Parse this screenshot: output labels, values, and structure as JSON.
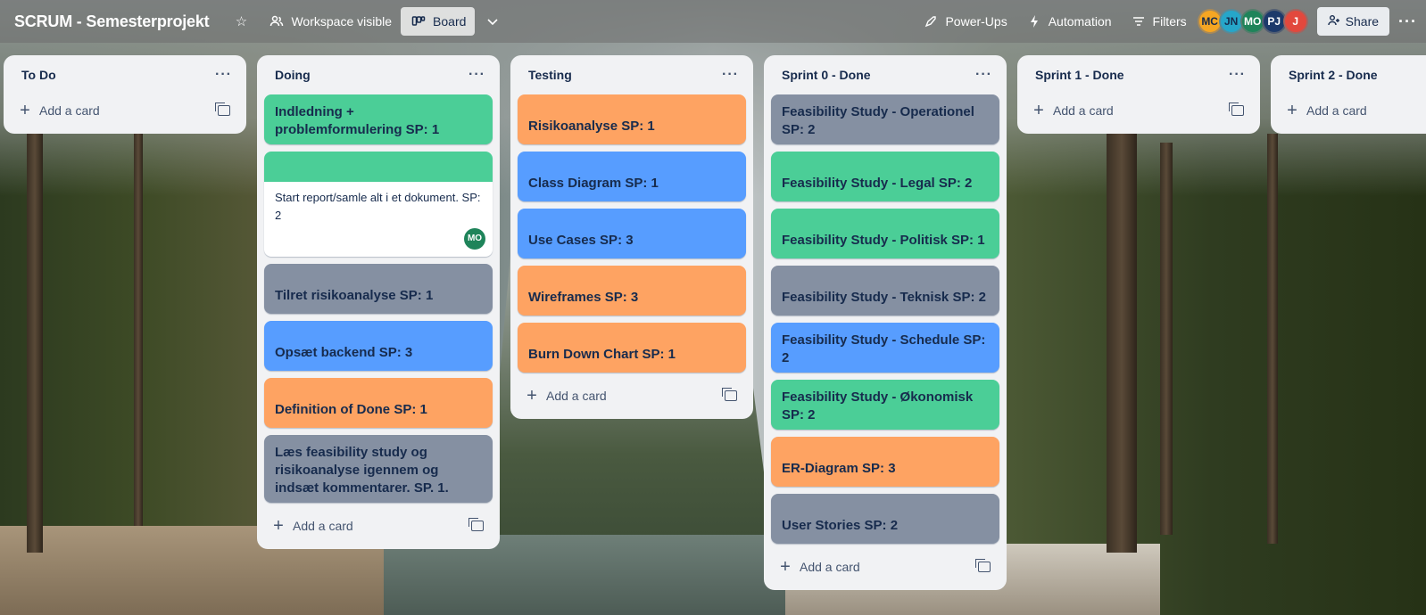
{
  "board": {
    "title": "SCRUM - Semesterprojekt",
    "visibility_label": "Workspace visible",
    "view_label": "Board",
    "powerups_label": "Power-Ups",
    "automation_label": "Automation",
    "filters_label": "Filters",
    "share_label": "Share",
    "more_label": "···"
  },
  "members": [
    {
      "initials": "MC",
      "color": "#f5a623"
    },
    {
      "initials": "JN",
      "color": "#26a6c9"
    },
    {
      "initials": "MO",
      "color": "#1f845a"
    },
    {
      "initials": "PJ",
      "color": "#1d3a6b"
    },
    {
      "initials": "J",
      "color": "#e2483d"
    }
  ],
  "add_card_label": "Add a card",
  "lists": [
    {
      "title": "To Do",
      "cards": []
    },
    {
      "title": "Doing",
      "cards": [
        {
          "text": "Indledning + problemformulering SP: 1",
          "color": "green"
        },
        {
          "text": "Start report/samle alt i et dokument. SP: 2",
          "color": "green",
          "member": "MO"
        },
        {
          "text": "Tilret risikoanalyse SP: 1",
          "color": "gray"
        },
        {
          "text": "Opsæt backend SP: 3",
          "color": "blue"
        },
        {
          "text": "Definition of Done SP: 1",
          "color": "orange"
        },
        {
          "text": "Læs feasibility study og risikoanalyse igennem og indsæt kommentarer. SP. 1.",
          "color": "gray"
        }
      ]
    },
    {
      "title": "Testing",
      "cards": [
        {
          "text": "Risikoanalyse SP: 1",
          "color": "orange"
        },
        {
          "text": "Class Diagram SP: 1",
          "color": "blue"
        },
        {
          "text": "Use Cases SP: 3",
          "color": "blue"
        },
        {
          "text": "Wireframes SP: 3",
          "color": "orange"
        },
        {
          "text": "Burn Down Chart SP: 1",
          "color": "orange"
        }
      ]
    },
    {
      "title": "Sprint 0 - Done",
      "cards": [
        {
          "text": "Feasibility Study - Operationel SP: 2",
          "color": "gray"
        },
        {
          "text": "Feasibility Study - Legal SP: 2",
          "color": "green"
        },
        {
          "text": "Feasibility Study - Politisk SP: 1",
          "color": "green"
        },
        {
          "text": "Feasibility Study - Teknisk SP: 2",
          "color": "gray"
        },
        {
          "text": "Feasibility Study - Schedule SP: 2",
          "color": "blue"
        },
        {
          "text": "Feasibility Study - Økonomisk SP: 2",
          "color": "green"
        },
        {
          "text": "ER-Diagram SP: 3",
          "color": "orange"
        },
        {
          "text": "User Stories SP: 2",
          "color": "gray"
        }
      ]
    },
    {
      "title": "Sprint 1 - Done",
      "cards": []
    },
    {
      "title": "Sprint 2 - Done",
      "cards": []
    }
  ]
}
